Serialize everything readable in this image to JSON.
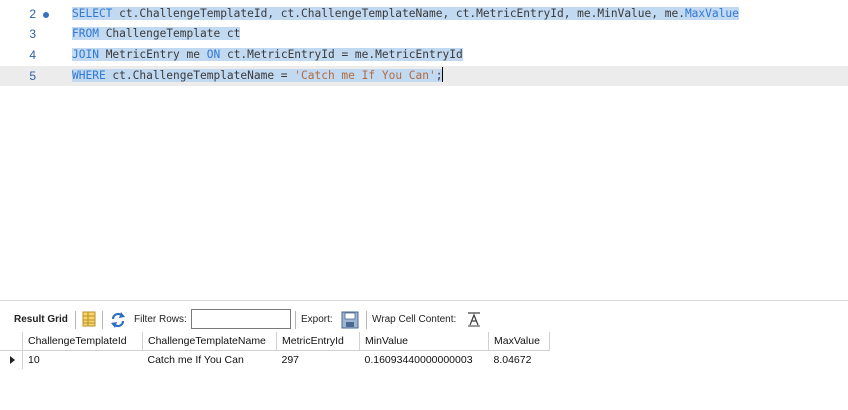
{
  "editor": {
    "lines": [
      {
        "number": "2",
        "parts": [
          {
            "t": "SELECT",
            "cls": "kw"
          },
          {
            "t": " ct.ChallengeTemplateId, ct.ChallengeTemplateName, ct.MetricEntryId, me.MinValue, me.",
            "cls": ""
          },
          {
            "t": "MaxValue",
            "cls": "kw"
          }
        ]
      },
      {
        "number": "3",
        "parts": [
          {
            "t": "FROM",
            "cls": "kw"
          },
          {
            "t": " ChallengeTemplate ct",
            "cls": ""
          }
        ]
      },
      {
        "number": "4",
        "parts": [
          {
            "t": "JOIN",
            "cls": "kw"
          },
          {
            "t": " MetricEntry me ",
            "cls": ""
          },
          {
            "t": "ON",
            "cls": "kw"
          },
          {
            "t": " ct.MetricEntryId = me.MetricEntryId",
            "cls": ""
          }
        ]
      },
      {
        "number": "5",
        "parts": [
          {
            "t": "WHERE",
            "cls": "kw"
          },
          {
            "t": " ct.ChallengeTemplateName = ",
            "cls": ""
          },
          {
            "t": "'Catch me If You Can'",
            "cls": "str"
          },
          {
            "t": ";",
            "cls": ""
          }
        ]
      }
    ]
  },
  "toolbar": {
    "result_grid_label": "Result Grid",
    "filter_rows_label": "Filter Rows:",
    "filter_value": "",
    "export_label": "Export:",
    "wrap_label": "Wrap Cell Content:"
  },
  "grid": {
    "columns": [
      "ChallengeTemplateId",
      "ChallengeTemplateName",
      "MetricEntryId",
      "MinValue",
      "MaxValue"
    ],
    "rows": [
      [
        "10",
        "Catch me If You Can",
        "297",
        "0.16093440000000003",
        "8.04672"
      ]
    ]
  },
  "colors": {
    "keyword": "#2f78d6",
    "string": "#b36b3e",
    "selection": "#c2d9f2",
    "line_number": "#2b5fa8"
  }
}
